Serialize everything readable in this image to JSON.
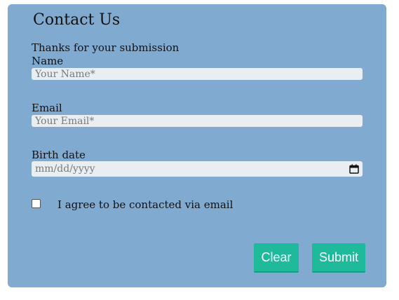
{
  "form": {
    "title": "Contact Us",
    "message": "Thanks for your submission",
    "name_label": "Name",
    "name_placeholder": "Your Name*",
    "email_label": "Email",
    "email_placeholder": "Your Email*",
    "birth_label": "Birth date",
    "birth_placeholder": "mm/dd/yyyy",
    "consent_label": "I agree to be contacted via email",
    "consent_checked": false,
    "clear_label": "Clear",
    "submit_label": "Submit"
  },
  "colors": {
    "card_background": "#81aad0",
    "field_background": "#e9eef2",
    "button_background": "#1fba9b",
    "button_text": "#ffffff"
  },
  "icons": {
    "date_picker": "calendar-icon"
  }
}
